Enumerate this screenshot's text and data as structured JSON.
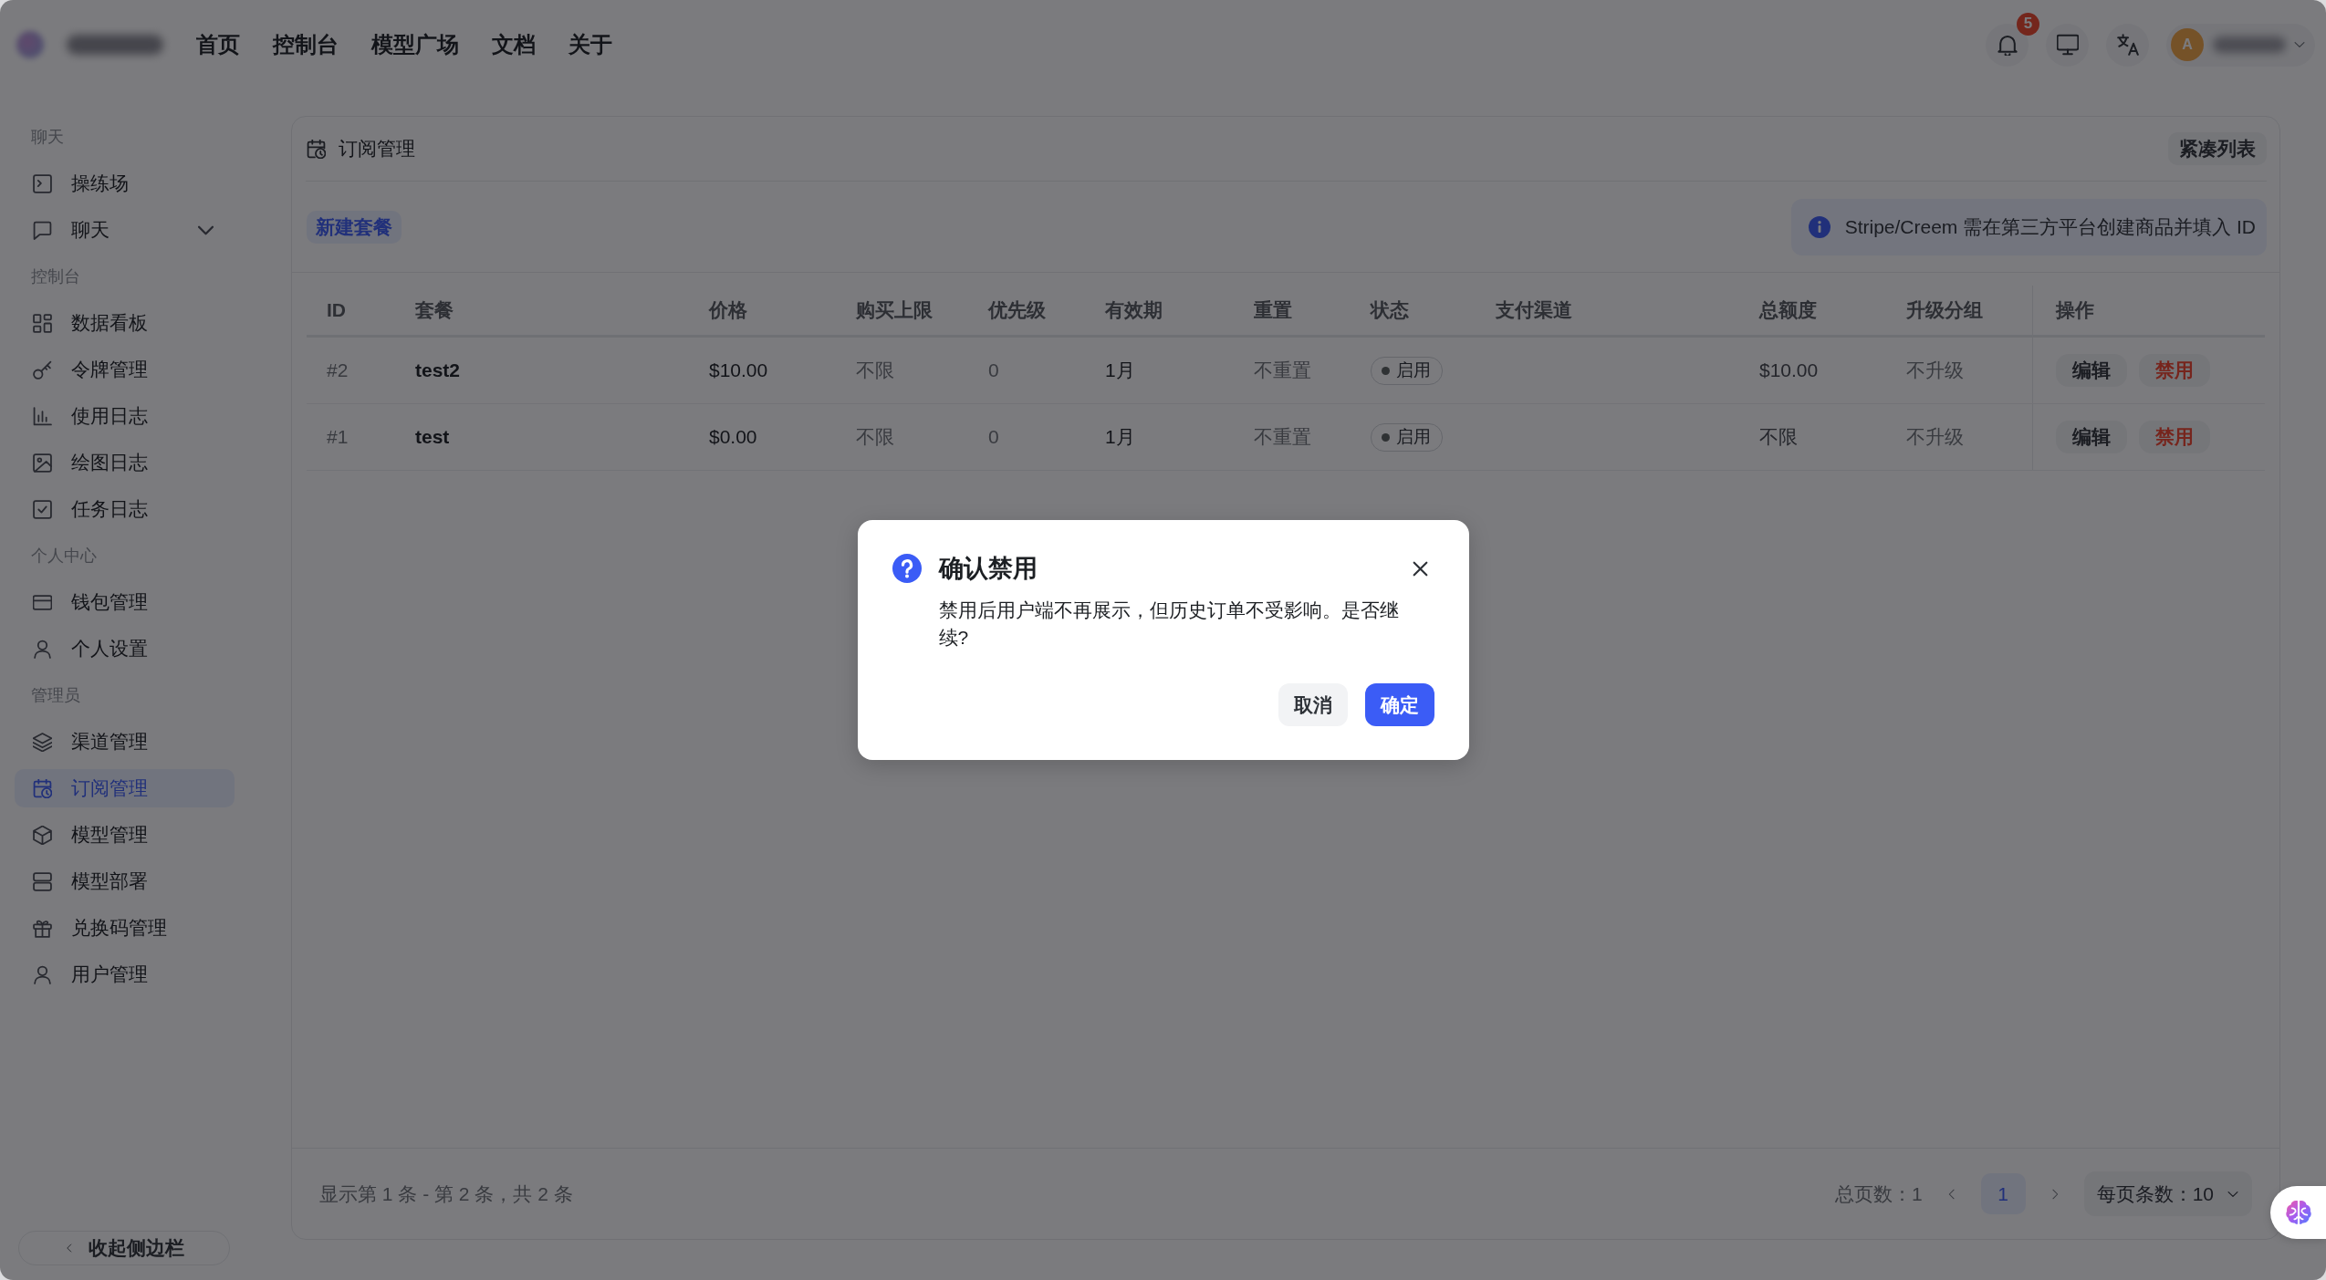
{
  "topbar": {
    "nav": [
      {
        "label": "首页"
      },
      {
        "label": "控制台"
      },
      {
        "label": "模型广场"
      },
      {
        "label": "文档"
      },
      {
        "label": "关于"
      }
    ],
    "notifications": {
      "badge": "5"
    },
    "user": {
      "initial": "A"
    }
  },
  "sidebar": {
    "sections": [
      {
        "label": "聊天",
        "items": [
          {
            "label": "操练场",
            "selected": false
          },
          {
            "label": "聊天",
            "selected": false,
            "expanded": false
          }
        ]
      },
      {
        "label": "控制台",
        "items": [
          {
            "label": "数据看板",
            "selected": false
          },
          {
            "label": "令牌管理",
            "selected": false
          },
          {
            "label": "使用日志",
            "selected": false
          },
          {
            "label": "绘图日志",
            "selected": false
          },
          {
            "label": "任务日志",
            "selected": false
          }
        ]
      },
      {
        "label": "个人中心",
        "items": [
          {
            "label": "钱包管理",
            "selected": false
          },
          {
            "label": "个人设置",
            "selected": false
          }
        ]
      },
      {
        "label": "管理员",
        "items": [
          {
            "label": "渠道管理",
            "selected": false
          },
          {
            "label": "订阅管理",
            "selected": true
          },
          {
            "label": "模型管理",
            "selected": false
          },
          {
            "label": "模型部署",
            "selected": false
          },
          {
            "label": "兑换码管理",
            "selected": false
          },
          {
            "label": "用户管理",
            "selected": false
          }
        ]
      }
    ],
    "collapse_button": "收起侧边栏"
  },
  "panel": {
    "title": "订阅管理",
    "compact_button": "紧凑列表",
    "new_button": "新建套餐",
    "notice": "Stripe/Creem 需在第三方平台创建商品并填入 ID"
  },
  "table": {
    "columns": [
      "ID",
      "套餐",
      "价格",
      "购买上限",
      "优先级",
      "有效期",
      "重置",
      "状态",
      "支付渠道",
      "总额度",
      "升级分组",
      "操作"
    ],
    "rows": [
      {
        "id": "#2",
        "plan": "test2",
        "price": "$10.00",
        "purchase_limit": "不限",
        "priority": "0",
        "validity": "1月",
        "reset": "不重置",
        "status": "启用",
        "total_quota": "$10.00",
        "upgrade_group": "不升级",
        "actions": [
          {
            "label": "编辑",
            "kind": "edit"
          },
          {
            "label": "禁用",
            "kind": "disable"
          }
        ]
      },
      {
        "id": "#1",
        "plan": "test",
        "price": "$0.00",
        "purchase_limit": "不限",
        "priority": "0",
        "validity": "1月",
        "reset": "不重置",
        "status": "启用",
        "total_quota": "不限",
        "upgrade_group": "不升级",
        "actions": [
          {
            "label": "编辑",
            "kind": "edit"
          },
          {
            "label": "禁用",
            "kind": "disable"
          }
        ]
      }
    ]
  },
  "pagination": {
    "summary": "显示第 1 条 - 第 2 条，共 2 条",
    "total_pages": "总页数：1",
    "pages": [
      {
        "label": "1",
        "selected": true
      }
    ],
    "page_size": "每页条数：10"
  },
  "modal": {
    "title": "确认禁用",
    "message": "禁用后用户端不再展示，但历史订单不受影响。是否继续?",
    "buttons": [
      {
        "label": "取消",
        "kind": "cancel"
      },
      {
        "label": "确定",
        "kind": "confirm"
      }
    ]
  }
}
